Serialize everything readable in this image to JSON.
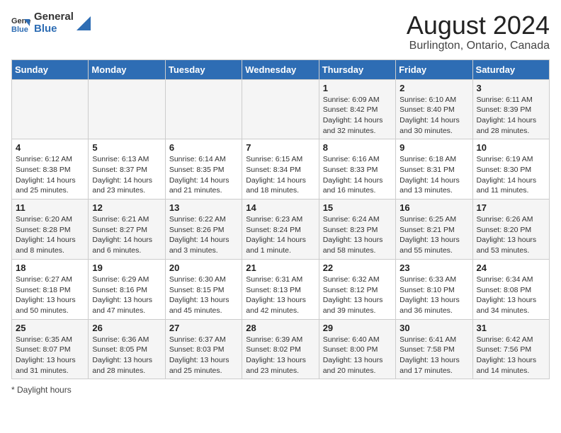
{
  "header": {
    "logo_line1": "General",
    "logo_line2": "Blue",
    "title": "August 2024",
    "subtitle": "Burlington, Ontario, Canada"
  },
  "days_of_week": [
    "Sunday",
    "Monday",
    "Tuesday",
    "Wednesday",
    "Thursday",
    "Friday",
    "Saturday"
  ],
  "weeks": [
    [
      {
        "day": "",
        "info": ""
      },
      {
        "day": "",
        "info": ""
      },
      {
        "day": "",
        "info": ""
      },
      {
        "day": "",
        "info": ""
      },
      {
        "day": "1",
        "info": "Sunrise: 6:09 AM\nSunset: 8:42 PM\nDaylight: 14 hours\nand 32 minutes."
      },
      {
        "day": "2",
        "info": "Sunrise: 6:10 AM\nSunset: 8:40 PM\nDaylight: 14 hours\nand 30 minutes."
      },
      {
        "day": "3",
        "info": "Sunrise: 6:11 AM\nSunset: 8:39 PM\nDaylight: 14 hours\nand 28 minutes."
      }
    ],
    [
      {
        "day": "4",
        "info": "Sunrise: 6:12 AM\nSunset: 8:38 PM\nDaylight: 14 hours\nand 25 minutes."
      },
      {
        "day": "5",
        "info": "Sunrise: 6:13 AM\nSunset: 8:37 PM\nDaylight: 14 hours\nand 23 minutes."
      },
      {
        "day": "6",
        "info": "Sunrise: 6:14 AM\nSunset: 8:35 PM\nDaylight: 14 hours\nand 21 minutes."
      },
      {
        "day": "7",
        "info": "Sunrise: 6:15 AM\nSunset: 8:34 PM\nDaylight: 14 hours\nand 18 minutes."
      },
      {
        "day": "8",
        "info": "Sunrise: 6:16 AM\nSunset: 8:33 PM\nDaylight: 14 hours\nand 16 minutes."
      },
      {
        "day": "9",
        "info": "Sunrise: 6:18 AM\nSunset: 8:31 PM\nDaylight: 14 hours\nand 13 minutes."
      },
      {
        "day": "10",
        "info": "Sunrise: 6:19 AM\nSunset: 8:30 PM\nDaylight: 14 hours\nand 11 minutes."
      }
    ],
    [
      {
        "day": "11",
        "info": "Sunrise: 6:20 AM\nSunset: 8:28 PM\nDaylight: 14 hours\nand 8 minutes."
      },
      {
        "day": "12",
        "info": "Sunrise: 6:21 AM\nSunset: 8:27 PM\nDaylight: 14 hours\nand 6 minutes."
      },
      {
        "day": "13",
        "info": "Sunrise: 6:22 AM\nSunset: 8:26 PM\nDaylight: 14 hours\nand 3 minutes."
      },
      {
        "day": "14",
        "info": "Sunrise: 6:23 AM\nSunset: 8:24 PM\nDaylight: 14 hours\nand 1 minute."
      },
      {
        "day": "15",
        "info": "Sunrise: 6:24 AM\nSunset: 8:23 PM\nDaylight: 13 hours\nand 58 minutes."
      },
      {
        "day": "16",
        "info": "Sunrise: 6:25 AM\nSunset: 8:21 PM\nDaylight: 13 hours\nand 55 minutes."
      },
      {
        "day": "17",
        "info": "Sunrise: 6:26 AM\nSunset: 8:20 PM\nDaylight: 13 hours\nand 53 minutes."
      }
    ],
    [
      {
        "day": "18",
        "info": "Sunrise: 6:27 AM\nSunset: 8:18 PM\nDaylight: 13 hours\nand 50 minutes."
      },
      {
        "day": "19",
        "info": "Sunrise: 6:29 AM\nSunset: 8:16 PM\nDaylight: 13 hours\nand 47 minutes."
      },
      {
        "day": "20",
        "info": "Sunrise: 6:30 AM\nSunset: 8:15 PM\nDaylight: 13 hours\nand 45 minutes."
      },
      {
        "day": "21",
        "info": "Sunrise: 6:31 AM\nSunset: 8:13 PM\nDaylight: 13 hours\nand 42 minutes."
      },
      {
        "day": "22",
        "info": "Sunrise: 6:32 AM\nSunset: 8:12 PM\nDaylight: 13 hours\nand 39 minutes."
      },
      {
        "day": "23",
        "info": "Sunrise: 6:33 AM\nSunset: 8:10 PM\nDaylight: 13 hours\nand 36 minutes."
      },
      {
        "day": "24",
        "info": "Sunrise: 6:34 AM\nSunset: 8:08 PM\nDaylight: 13 hours\nand 34 minutes."
      }
    ],
    [
      {
        "day": "25",
        "info": "Sunrise: 6:35 AM\nSunset: 8:07 PM\nDaylight: 13 hours\nand 31 minutes."
      },
      {
        "day": "26",
        "info": "Sunrise: 6:36 AM\nSunset: 8:05 PM\nDaylight: 13 hours\nand 28 minutes."
      },
      {
        "day": "27",
        "info": "Sunrise: 6:37 AM\nSunset: 8:03 PM\nDaylight: 13 hours\nand 25 minutes."
      },
      {
        "day": "28",
        "info": "Sunrise: 6:39 AM\nSunset: 8:02 PM\nDaylight: 13 hours\nand 23 minutes."
      },
      {
        "day": "29",
        "info": "Sunrise: 6:40 AM\nSunset: 8:00 PM\nDaylight: 13 hours\nand 20 minutes."
      },
      {
        "day": "30",
        "info": "Sunrise: 6:41 AM\nSunset: 7:58 PM\nDaylight: 13 hours\nand 17 minutes."
      },
      {
        "day": "31",
        "info": "Sunrise: 6:42 AM\nSunset: 7:56 PM\nDaylight: 13 hours\nand 14 minutes."
      }
    ]
  ],
  "footer": {
    "note": "Daylight hours"
  }
}
